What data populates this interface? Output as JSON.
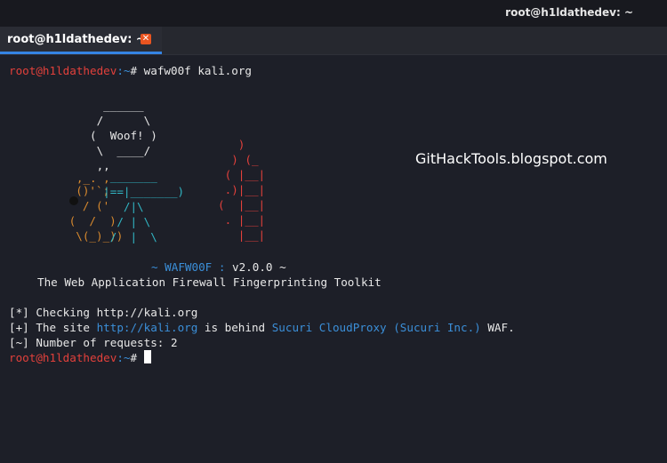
{
  "window": {
    "title": "root@h1ldathedev: ~"
  },
  "tab": {
    "label": "root@h1ldathedev: ~",
    "close_glyph": "✕"
  },
  "prompt": {
    "user_host": "root@h1ldathedev",
    "path": ":~",
    "symbol": "# "
  },
  "command": "wafw00f kali.org",
  "ascii_art": {
    "hexagon": "              ______\n             /      \\\n            (  Woof! )\n             \\  ____/",
    "ticks": "             ,,",
    "dog_head": "          ,_. ,",
    "dog_body": "         ()'`;\n          / ('\n        (  /  )\n         \\(_)_))",
    "bucket": "               _______\n              |==|_______)\n                 /|\\\n                / | \\\n               /  |  \\",
    "fire": "                                  )\n                                 ) (_\n                                ( |__|\n                                .)|__|\n                               (  |__|\n                                . |__|\n                                  |__|"
  },
  "banner": {
    "name_line": "~ WAFW00F : ",
    "version": "v2.0.0",
    "tail": " ~",
    "subtitle": "The Web Application Firewall Fingerprinting Toolkit"
  },
  "output": {
    "checking_prefix": "[*] Checking ",
    "checking_url": "http://kali.org",
    "site_prefix": "[+] The site ",
    "site_url": "http://kali.org",
    "behind_text": " is behind ",
    "waf_name": "Sucuri CloudProxy (Sucuri Inc.)",
    "waf_suffix": " WAF.",
    "requests_prefix": "[~] Number of requests: ",
    "requests_count": "2"
  },
  "watermark": "GitHackTools.blogspot.com",
  "colors": {
    "prompt_red": "#e2403b",
    "link_blue": "#3b8fd9",
    "art_orange": "#d98a2e",
    "art_cyan": "#31b6c4",
    "tab_accent": "#3584e4",
    "close_orange": "#e95420"
  }
}
